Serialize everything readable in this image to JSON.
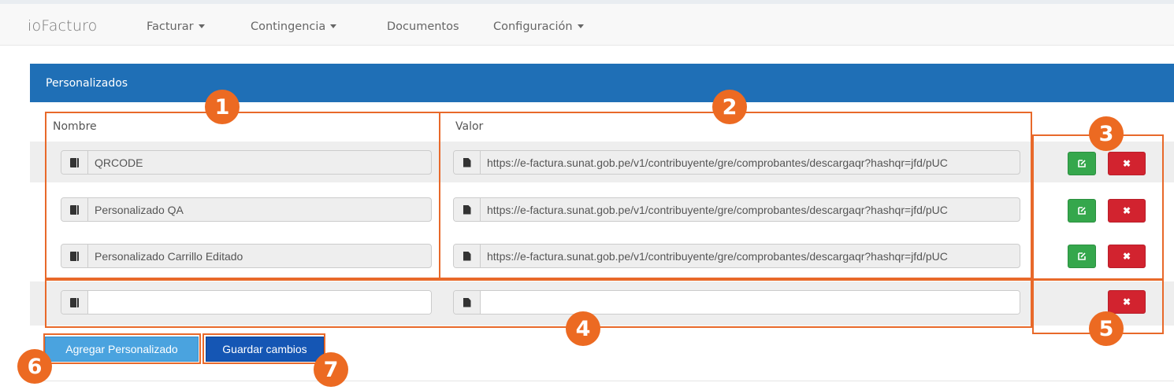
{
  "navbar": {
    "brand": "ioFacturo",
    "items": [
      {
        "label": "Facturar",
        "dropdown": true
      },
      {
        "label": "Contingencia",
        "dropdown": true
      },
      {
        "label": "Documentos",
        "dropdown": false
      },
      {
        "label": "Configuración",
        "dropdown": true
      }
    ]
  },
  "panel": {
    "title": "Personalizados",
    "columns": {
      "name": "Nombre",
      "value": "Valor"
    },
    "rows": [
      {
        "name": "QRCODE",
        "value": "https://e-factura.sunat.gob.pe/v1/contribuyente/gre/comprobantes/descargaqr?hashqr=jfd/pUC"
      },
      {
        "name": "Personalizado QA",
        "value": "https://e-factura.sunat.gob.pe/v1/contribuyente/gre/comprobantes/descargaqr?hashqr=jfd/pUC"
      },
      {
        "name": "Personalizado Carrillo Editado",
        "value": "https://e-factura.sunat.gob.pe/v1/contribuyente/gre/comprobantes/descargaqr?hashqr=jfd/pUC"
      }
    ],
    "new_row": {
      "name": "",
      "value": ""
    },
    "buttons": {
      "edit_icon": "edit-icon",
      "delete_label": "✖"
    }
  },
  "actions": {
    "add_label": "Agregar Personalizado",
    "save_label": "Guardar cambios"
  },
  "annotations": [
    "1",
    "2",
    "3",
    "4",
    "5",
    "6",
    "7"
  ],
  "colors": {
    "panel_header": "#1f6fb6",
    "edit_button": "#35a74c",
    "delete_button": "#d2232f",
    "add_button": "#4aa3df",
    "save_button": "#1556b4",
    "annotation": "#ec6a22"
  }
}
